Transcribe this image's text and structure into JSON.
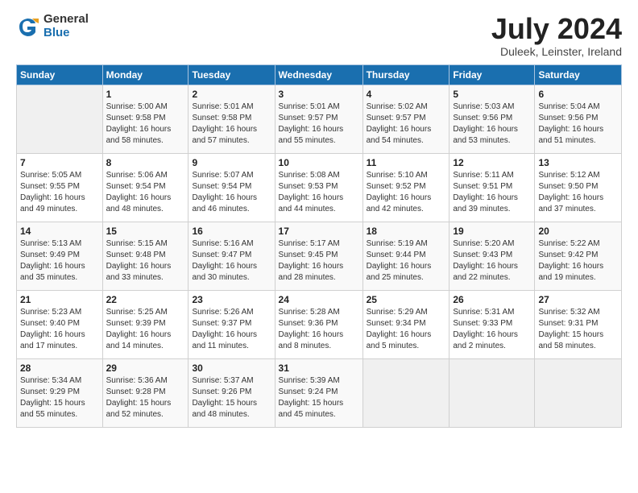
{
  "logo": {
    "general": "General",
    "blue": "Blue"
  },
  "title": "July 2024",
  "location": "Duleek, Leinster, Ireland",
  "days_of_week": [
    "Sunday",
    "Monday",
    "Tuesday",
    "Wednesday",
    "Thursday",
    "Friday",
    "Saturday"
  ],
  "weeks": [
    [
      {
        "day": "",
        "sunrise": "",
        "sunset": "",
        "daylight": ""
      },
      {
        "day": "1",
        "sunrise": "Sunrise: 5:00 AM",
        "sunset": "Sunset: 9:58 PM",
        "daylight": "Daylight: 16 hours and 58 minutes."
      },
      {
        "day": "2",
        "sunrise": "Sunrise: 5:01 AM",
        "sunset": "Sunset: 9:58 PM",
        "daylight": "Daylight: 16 hours and 57 minutes."
      },
      {
        "day": "3",
        "sunrise": "Sunrise: 5:01 AM",
        "sunset": "Sunset: 9:57 PM",
        "daylight": "Daylight: 16 hours and 55 minutes."
      },
      {
        "day": "4",
        "sunrise": "Sunrise: 5:02 AM",
        "sunset": "Sunset: 9:57 PM",
        "daylight": "Daylight: 16 hours and 54 minutes."
      },
      {
        "day": "5",
        "sunrise": "Sunrise: 5:03 AM",
        "sunset": "Sunset: 9:56 PM",
        "daylight": "Daylight: 16 hours and 53 minutes."
      },
      {
        "day": "6",
        "sunrise": "Sunrise: 5:04 AM",
        "sunset": "Sunset: 9:56 PM",
        "daylight": "Daylight: 16 hours and 51 minutes."
      }
    ],
    [
      {
        "day": "7",
        "sunrise": "Sunrise: 5:05 AM",
        "sunset": "Sunset: 9:55 PM",
        "daylight": "Daylight: 16 hours and 49 minutes."
      },
      {
        "day": "8",
        "sunrise": "Sunrise: 5:06 AM",
        "sunset": "Sunset: 9:54 PM",
        "daylight": "Daylight: 16 hours and 48 minutes."
      },
      {
        "day": "9",
        "sunrise": "Sunrise: 5:07 AM",
        "sunset": "Sunset: 9:54 PM",
        "daylight": "Daylight: 16 hours and 46 minutes."
      },
      {
        "day": "10",
        "sunrise": "Sunrise: 5:08 AM",
        "sunset": "Sunset: 9:53 PM",
        "daylight": "Daylight: 16 hours and 44 minutes."
      },
      {
        "day": "11",
        "sunrise": "Sunrise: 5:10 AM",
        "sunset": "Sunset: 9:52 PM",
        "daylight": "Daylight: 16 hours and 42 minutes."
      },
      {
        "day": "12",
        "sunrise": "Sunrise: 5:11 AM",
        "sunset": "Sunset: 9:51 PM",
        "daylight": "Daylight: 16 hours and 39 minutes."
      },
      {
        "day": "13",
        "sunrise": "Sunrise: 5:12 AM",
        "sunset": "Sunset: 9:50 PM",
        "daylight": "Daylight: 16 hours and 37 minutes."
      }
    ],
    [
      {
        "day": "14",
        "sunrise": "Sunrise: 5:13 AM",
        "sunset": "Sunset: 9:49 PM",
        "daylight": "Daylight: 16 hours and 35 minutes."
      },
      {
        "day": "15",
        "sunrise": "Sunrise: 5:15 AM",
        "sunset": "Sunset: 9:48 PM",
        "daylight": "Daylight: 16 hours and 33 minutes."
      },
      {
        "day": "16",
        "sunrise": "Sunrise: 5:16 AM",
        "sunset": "Sunset: 9:47 PM",
        "daylight": "Daylight: 16 hours and 30 minutes."
      },
      {
        "day": "17",
        "sunrise": "Sunrise: 5:17 AM",
        "sunset": "Sunset: 9:45 PM",
        "daylight": "Daylight: 16 hours and 28 minutes."
      },
      {
        "day": "18",
        "sunrise": "Sunrise: 5:19 AM",
        "sunset": "Sunset: 9:44 PM",
        "daylight": "Daylight: 16 hours and 25 minutes."
      },
      {
        "day": "19",
        "sunrise": "Sunrise: 5:20 AM",
        "sunset": "Sunset: 9:43 PM",
        "daylight": "Daylight: 16 hours and 22 minutes."
      },
      {
        "day": "20",
        "sunrise": "Sunrise: 5:22 AM",
        "sunset": "Sunset: 9:42 PM",
        "daylight": "Daylight: 16 hours and 19 minutes."
      }
    ],
    [
      {
        "day": "21",
        "sunrise": "Sunrise: 5:23 AM",
        "sunset": "Sunset: 9:40 PM",
        "daylight": "Daylight: 16 hours and 17 minutes."
      },
      {
        "day": "22",
        "sunrise": "Sunrise: 5:25 AM",
        "sunset": "Sunset: 9:39 PM",
        "daylight": "Daylight: 16 hours and 14 minutes."
      },
      {
        "day": "23",
        "sunrise": "Sunrise: 5:26 AM",
        "sunset": "Sunset: 9:37 PM",
        "daylight": "Daylight: 16 hours and 11 minutes."
      },
      {
        "day": "24",
        "sunrise": "Sunrise: 5:28 AM",
        "sunset": "Sunset: 9:36 PM",
        "daylight": "Daylight: 16 hours and 8 minutes."
      },
      {
        "day": "25",
        "sunrise": "Sunrise: 5:29 AM",
        "sunset": "Sunset: 9:34 PM",
        "daylight": "Daylight: 16 hours and 5 minutes."
      },
      {
        "day": "26",
        "sunrise": "Sunrise: 5:31 AM",
        "sunset": "Sunset: 9:33 PM",
        "daylight": "Daylight: 16 hours and 2 minutes."
      },
      {
        "day": "27",
        "sunrise": "Sunrise: 5:32 AM",
        "sunset": "Sunset: 9:31 PM",
        "daylight": "Daylight: 15 hours and 58 minutes."
      }
    ],
    [
      {
        "day": "28",
        "sunrise": "Sunrise: 5:34 AM",
        "sunset": "Sunset: 9:29 PM",
        "daylight": "Daylight: 15 hours and 55 minutes."
      },
      {
        "day": "29",
        "sunrise": "Sunrise: 5:36 AM",
        "sunset": "Sunset: 9:28 PM",
        "daylight": "Daylight: 15 hours and 52 minutes."
      },
      {
        "day": "30",
        "sunrise": "Sunrise: 5:37 AM",
        "sunset": "Sunset: 9:26 PM",
        "daylight": "Daylight: 15 hours and 48 minutes."
      },
      {
        "day": "31",
        "sunrise": "Sunrise: 5:39 AM",
        "sunset": "Sunset: 9:24 PM",
        "daylight": "Daylight: 15 hours and 45 minutes."
      },
      {
        "day": "",
        "sunrise": "",
        "sunset": "",
        "daylight": ""
      },
      {
        "day": "",
        "sunrise": "",
        "sunset": "",
        "daylight": ""
      },
      {
        "day": "",
        "sunrise": "",
        "sunset": "",
        "daylight": ""
      }
    ]
  ]
}
